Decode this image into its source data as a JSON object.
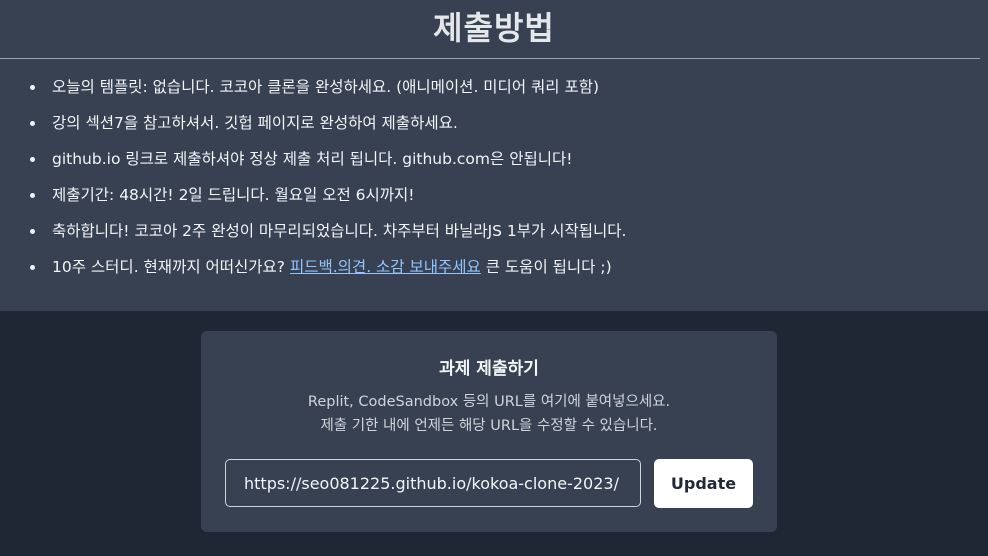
{
  "header": {
    "title": "제출방법"
  },
  "rules": [
    {
      "text": "오늘의 템플릿: 없습니다. 코코아 클론을 완성하세요. (애니메이션. 미디어 쿼리 포함)"
    },
    {
      "text": "강의 섹션7을 참고하셔서. 깃헙 페이지로 완성하여 제출하세요."
    },
    {
      "text": "github.io 링크로 제출하셔야 정상 제출 처리 됩니다. github.com은 안됩니다!"
    },
    {
      "text": "제출기간: 48시간! 2일 드립니다. 월요일 오전 6시까지!"
    },
    {
      "text": "축하합니다! 코코아 2주 완성이 마무리되었습니다. 차주부터 바닐라JS 1부가 시작됩니다."
    },
    {
      "text_before": "10주 스터디. 현재까지 어떠신가요? ",
      "link_text": "피드백.의견. 소감 보내주세요",
      "text_after": " 큰 도움이 됩니다 ;)"
    }
  ],
  "submission": {
    "title": "과제 제출하기",
    "description_line1": "Replit, CodeSandbox 등의 URL를 여기에 붙여넣으세요.",
    "description_line2": "제출 기한 내에 언제든 해당 URL을 수정할 수 있습니다.",
    "url_value": "https://seo081225.github.io/kokoa-clone-2023/",
    "update_label": "Update"
  },
  "colors": {
    "page_background": "#1f2735",
    "panel_background": "#374151",
    "link": "#93c5fd",
    "button_background": "#ffffff"
  }
}
